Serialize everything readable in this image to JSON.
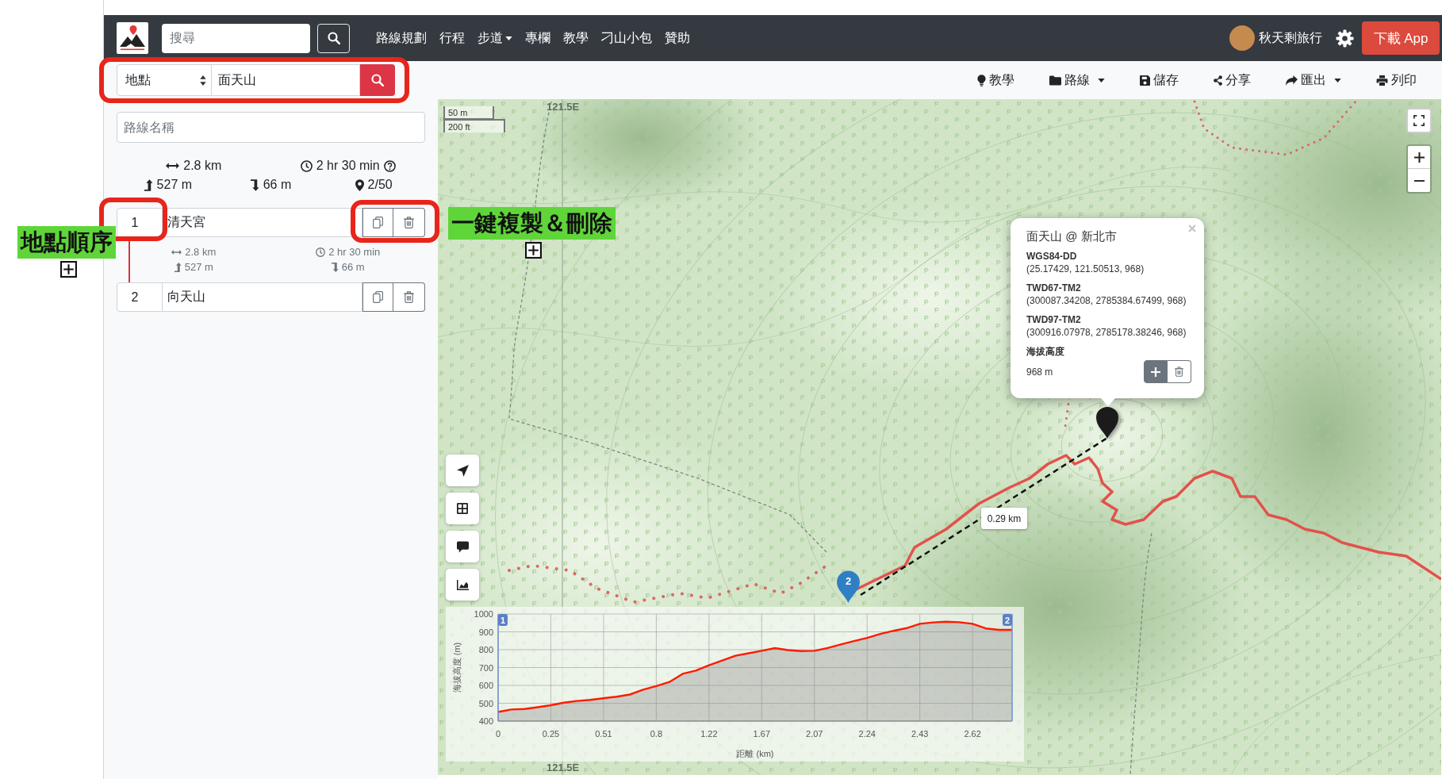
{
  "navbar": {
    "search_placeholder": "搜尋",
    "links": [
      {
        "label": "路線規劃",
        "dropdown": false
      },
      {
        "label": "行程",
        "dropdown": false
      },
      {
        "label": "步道",
        "dropdown": true
      },
      {
        "label": "專欄",
        "dropdown": false
      },
      {
        "label": "教學",
        "dropdown": false
      },
      {
        "label": "刁山小包",
        "dropdown": false
      },
      {
        "label": "贊助",
        "dropdown": false
      }
    ],
    "user_name": "秋天剩旅行",
    "download_button": "下載 App"
  },
  "toolbar": [
    {
      "label": "教學",
      "dropdown": false
    },
    {
      "label": "路線",
      "dropdown": true
    },
    {
      "label": "儲存",
      "dropdown": false
    },
    {
      "label": "分享",
      "dropdown": false
    },
    {
      "label": "匯出",
      "dropdown": true
    },
    {
      "label": "列印",
      "dropdown": false
    }
  ],
  "location_search": {
    "type": "地點",
    "value": "面天山"
  },
  "route_name": {
    "placeholder": "路線名稱"
  },
  "summary": {
    "distance": "2.8 km",
    "time": "2 hr 30 min",
    "ascent": "527 m",
    "descent": "66 m",
    "waypoint_count": "2/50"
  },
  "waypoints": [
    {
      "number": "1",
      "name": "清天宮"
    },
    {
      "number": "2",
      "name": "向天山"
    }
  ],
  "segments": [
    {
      "distance": "2.8 km",
      "time": "2 hr 30 min",
      "ascent": "527 m",
      "descent": "66 m"
    }
  ],
  "annotations": [
    "地點順序",
    "一鍵複製＆刪除"
  ],
  "map": {
    "scale": [
      "50 m",
      "200 ft"
    ],
    "graticule_labels": [
      "121.5E",
      "121.5E"
    ],
    "popup": {
      "title": "面天山 @ 新北市",
      "coordinates": [
        {
          "label": "WGS84-DD",
          "value": "(25.17429, 121.50513, 968)"
        },
        {
          "label": "TWD67-TM2",
          "value": "(300087.34208, 2785384.67499, 968)"
        },
        {
          "label": "TWD97-TM2",
          "value": "(300916.07978, 2785178.38246, 968)"
        }
      ],
      "elevation_label": "海拔高度",
      "elevation": "968 m"
    },
    "marker_number": "2",
    "distance_label": "0.29 km",
    "elevation_profile": {
      "waypoint_flags": [
        "1",
        "2"
      ],
      "chart_data": {
        "type": "area",
        "xlabel": "距離 (km)",
        "ylabel": "海拔高度 (m)",
        "categories": [
          "0",
          null,
          null,
          null,
          "0.25",
          null,
          null,
          null,
          "0.51",
          null,
          null,
          null,
          "0.8",
          null,
          null,
          null,
          "1.22",
          null,
          null,
          null,
          "1.67",
          null,
          null,
          null,
          "2.07",
          null,
          null,
          null,
          "2.24",
          null,
          null,
          null,
          "2.43",
          null,
          null,
          null,
          "2.62",
          null,
          null,
          null
        ],
        "values": [
          451,
          465,
          468,
          478,
          489,
          503,
          513,
          519,
          528,
          537,
          549,
          576,
          596,
          619,
          665,
          683,
          713,
          739,
          766,
          780,
          794,
          809,
          798,
          792,
          794,
          810,
          830,
          848,
          866,
          888,
          906,
          921,
          945,
          953,
          957,
          954,
          945,
          919,
          911,
          911
        ],
        "ylim": [
          400,
          1000
        ],
        "yticks": [
          400,
          500,
          600,
          700,
          800,
          900,
          1000
        ],
        "grid": true
      }
    }
  }
}
